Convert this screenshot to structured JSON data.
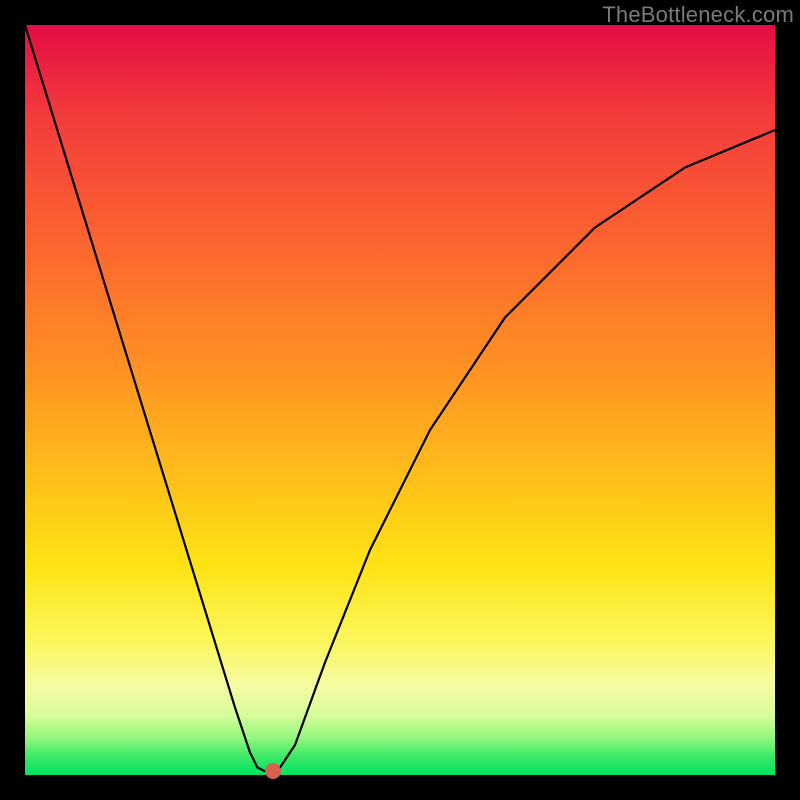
{
  "watermark": "TheBottleneck.com",
  "chart_data": {
    "type": "line",
    "title": "",
    "xlabel": "",
    "ylabel": "",
    "xlim": [
      0,
      100
    ],
    "ylim": [
      0,
      100
    ],
    "grid": false,
    "legend": false,
    "background_gradient": {
      "direction": "vertical",
      "stops": [
        {
          "pos": 0,
          "color": "#e40c45"
        },
        {
          "pos": 12,
          "color": "#f33b3c"
        },
        {
          "pos": 28,
          "color": "#fb6230"
        },
        {
          "pos": 45,
          "color": "#ff8f24"
        },
        {
          "pos": 60,
          "color": "#ffbe1a"
        },
        {
          "pos": 72,
          "color": "#fee314"
        },
        {
          "pos": 82,
          "color": "#fbf65b"
        },
        {
          "pos": 88,
          "color": "#f6fba2"
        },
        {
          "pos": 92,
          "color": "#d8fc9a"
        },
        {
          "pos": 95,
          "color": "#94f87e"
        },
        {
          "pos": 97.5,
          "color": "#3de967"
        },
        {
          "pos": 100,
          "color": "#00e260"
        }
      ]
    },
    "series": [
      {
        "name": "bottleneck-curve",
        "color": "#000000",
        "x": [
          0,
          4,
          8,
          12,
          16,
          20,
          24,
          28,
          30,
          31,
          32,
          33,
          34,
          36,
          40,
          46,
          54,
          64,
          76,
          88,
          100
        ],
        "y": [
          100,
          87,
          74,
          61,
          48,
          35,
          22,
          9,
          3,
          1,
          0.5,
          0.5,
          1,
          4,
          15,
          30,
          46,
          61,
          73,
          81,
          86
        ]
      }
    ],
    "marker": {
      "name": "optimal-point",
      "x": 33,
      "y": 0.5,
      "color": "#d7604f"
    }
  }
}
